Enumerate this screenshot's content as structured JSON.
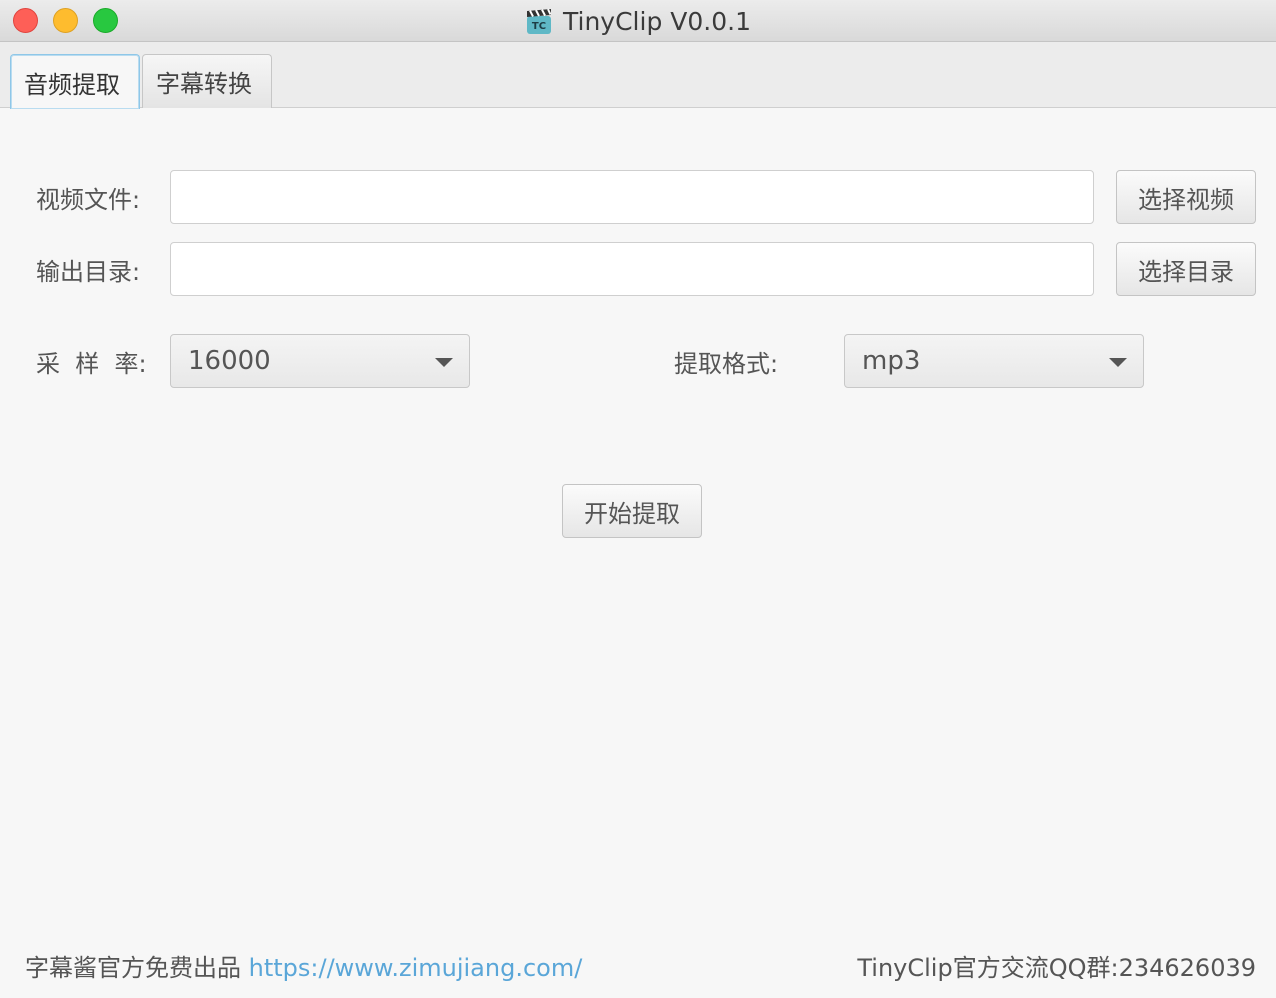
{
  "window": {
    "title": "TinyClip V0.0.1",
    "app_icon_text": "TC"
  },
  "tabs": [
    {
      "label": "音频提取",
      "active": true
    },
    {
      "label": "字幕转换",
      "active": false
    }
  ],
  "form": {
    "video_file": {
      "label": "视频文件:",
      "value": "",
      "button": "选择视频"
    },
    "output_dir": {
      "label": "输出目录:",
      "value": "",
      "button": "选择目录"
    },
    "sample_rate": {
      "label": "采  样  率:",
      "value": "16000"
    },
    "format": {
      "label": "提取格式:",
      "value": "mp3"
    },
    "start_button": "开始提取"
  },
  "footer": {
    "left_text": "字幕酱官方免费出品 ",
    "link": "https://www.zimujiang.com/",
    "right_text": "TinyClip官方交流QQ群:234626039"
  },
  "colors": {
    "accent_link": "#5aa6d8",
    "close": "#fe5f57",
    "minimize": "#febc2e",
    "maximize": "#28c840"
  }
}
